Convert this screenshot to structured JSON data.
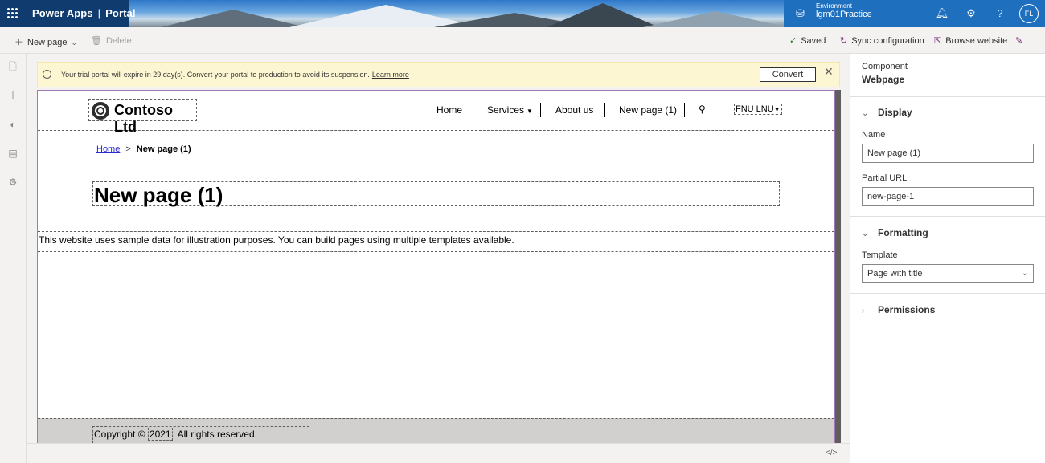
{
  "topbar": {
    "app_name": "Power Apps",
    "separator": "|",
    "section": "Portal",
    "environment_label": "Environment",
    "environment_name": "lgm01Practice",
    "avatar_initials": "FL"
  },
  "commandbar": {
    "new_page": "New page",
    "delete": "Delete",
    "saved": "Saved",
    "sync": "Sync configuration",
    "browse": "Browse website"
  },
  "trial": {
    "message": "Your trial portal will expire in 29 day(s). Convert your portal to production to avoid its suspension.",
    "learn_more": "Learn more",
    "convert": "Convert"
  },
  "site": {
    "logo_text": "Contoso Ltd",
    "nav": [
      "Home",
      "Services",
      "About us",
      "New page (1)"
    ],
    "user": "FNU LNU",
    "breadcrumb_home": "Home",
    "breadcrumb_sep": ">",
    "breadcrumb_current": "New page (1)",
    "page_title": "New page (1)",
    "sample_text": "This website uses sample data for illustration purposes. You can build pages using multiple templates available.",
    "copyright_prefix": "Copyright ©",
    "copyright_year": "2021",
    "copyright_suffix": ". All rights reserved."
  },
  "statusbar": {
    "code_toggle": "</>"
  },
  "panel": {
    "component_label": "Component",
    "component_value": "Webpage",
    "display": "Display",
    "name_label": "Name",
    "name_value": "New page (1)",
    "url_label": "Partial URL",
    "url_value": "new-page-1",
    "formatting": "Formatting",
    "template_label": "Template",
    "template_value": "Page with title",
    "permissions": "Permissions"
  },
  "colors": {
    "topbar": "#0f3b6e",
    "accent": "#742774",
    "trial_bg": "#fdf6d3"
  }
}
